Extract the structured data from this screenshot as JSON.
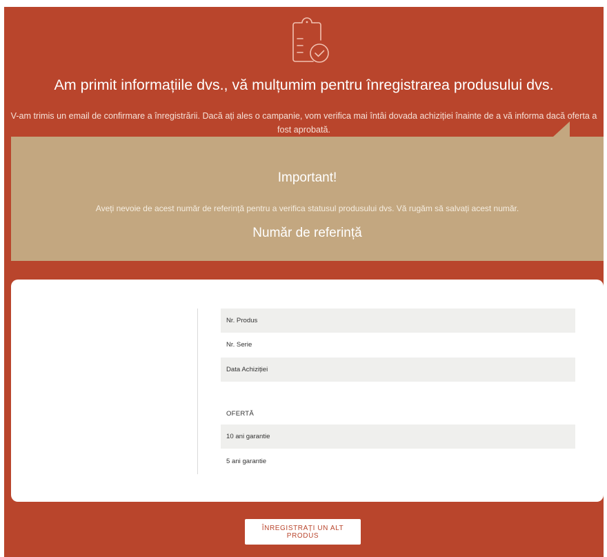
{
  "hero": {
    "title": "Am primit informațiile dvs., vă mulțumim pentru înregistrarea produsului dvs.",
    "subtitle": "V-am trimis un email de confirmare a înregistrării. Dacă ați ales o campanie, vom verifica mai întâi dovada achiziției înainte de a vă informa dacă oferta a fost aprobată."
  },
  "important": {
    "title": "Important!",
    "text": "Aveți nevoie de acest număr de referință pentru a verifica statusul produsului dvs. Vă rugăm să salvați acest număr.",
    "reference_label": "Număr de referință"
  },
  "details": {
    "product_no": "Nr. Produs",
    "serial_no": "Nr. Serie",
    "purchase_date": "Data Achiziției",
    "offer_header": "OFERTĂ",
    "offers": [
      "10 ani garantie",
      "5 ani garantie"
    ]
  },
  "actions": {
    "register_another": "Înregistrați un alt produs"
  },
  "colors": {
    "background": "#b9452c",
    "banner": "#c3a780",
    "row_shade": "#efefed"
  }
}
